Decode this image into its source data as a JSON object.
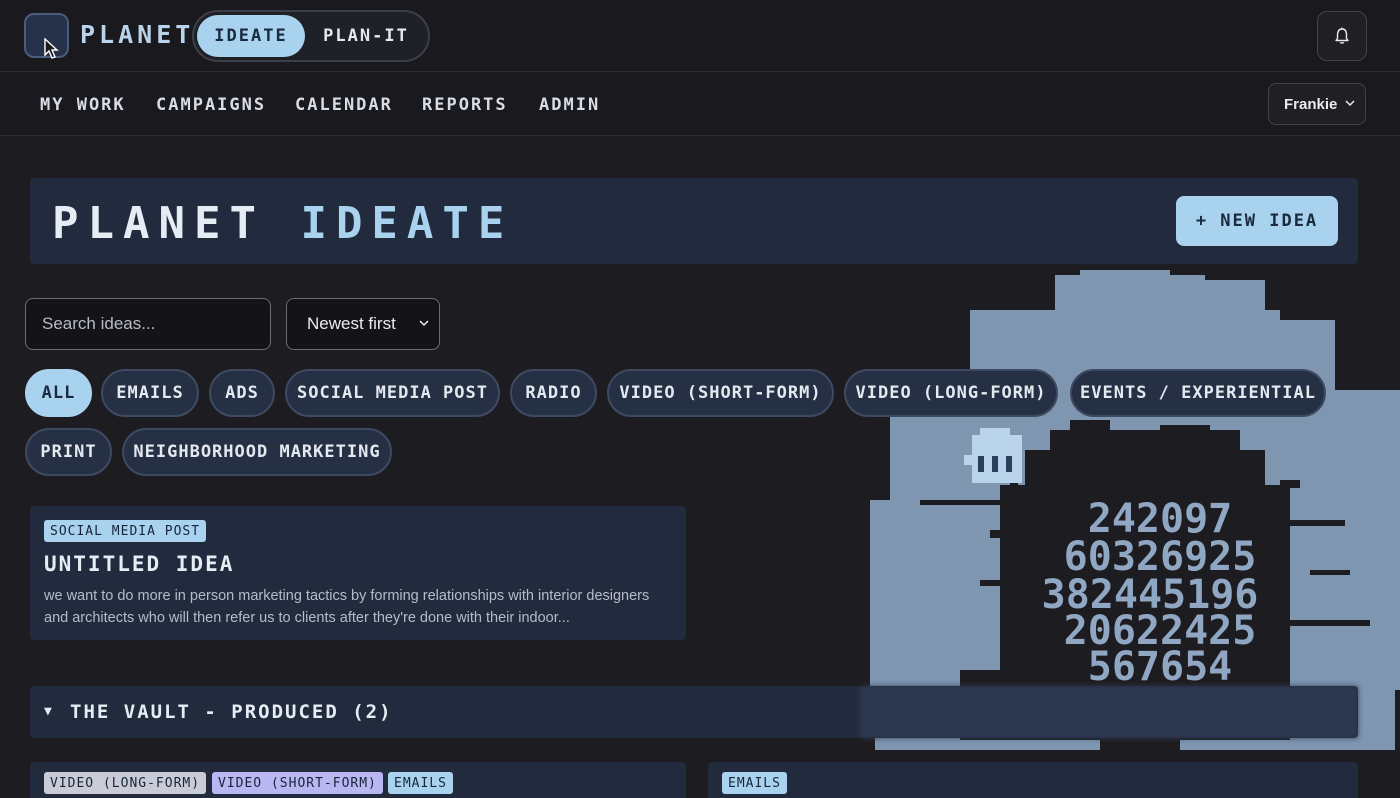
{
  "app": {
    "brand": "PLANET",
    "modes": [
      "IDEATE",
      "PLAN-IT"
    ],
    "active_mode": "IDEATE"
  },
  "nav": {
    "items": [
      "MY WORK",
      "CAMPAIGNS",
      "CALENDAR",
      "REPORTS",
      "ADMIN"
    ],
    "user": "Frankie"
  },
  "hero": {
    "title_main": "PLANET",
    "title_accent": "IDEATE",
    "new_idea_label": "+ NEW IDEA"
  },
  "filters": {
    "search_placeholder": "Search ideas...",
    "sort_value": "Newest first",
    "chips": [
      "ALL",
      "EMAILS",
      "ADS",
      "SOCIAL MEDIA POST",
      "RADIO",
      "VIDEO (SHORT-FORM)",
      "VIDEO (LONG-FORM)",
      "EVENTS / EXPERIENTIAL",
      "PRINT",
      "NEIGHBORHOOD MARKETING"
    ],
    "active_chip": "ALL"
  },
  "ideas": [
    {
      "tag": "SOCIAL MEDIA POST",
      "title": "UNTITLED IDEA",
      "description": "we want to do more in person marketing tactics by forming relationships with interior designers and architects who will then refer us to clients after they're done with their indoor..."
    }
  ],
  "vault": {
    "label": "THE VAULT - PRODUCED (2)",
    "arrow": "▼",
    "cards": [
      {
        "tags": [
          "VIDEO (LONG-FORM)",
          "VIDEO (SHORT-FORM)",
          "EMAILS"
        ]
      },
      {
        "tags": [
          "EMAILS"
        ]
      }
    ]
  },
  "art": {
    "numbers": [
      "242097",
      "60326925",
      "382445196",
      "20622425",
      "567654"
    ]
  },
  "colors": {
    "accent": "#a9d2ef",
    "background": "#1d1c20",
    "panel": "#222a3d",
    "tag_lavender": "#b9b6f2",
    "tag_grey": "#c9ccd6"
  }
}
